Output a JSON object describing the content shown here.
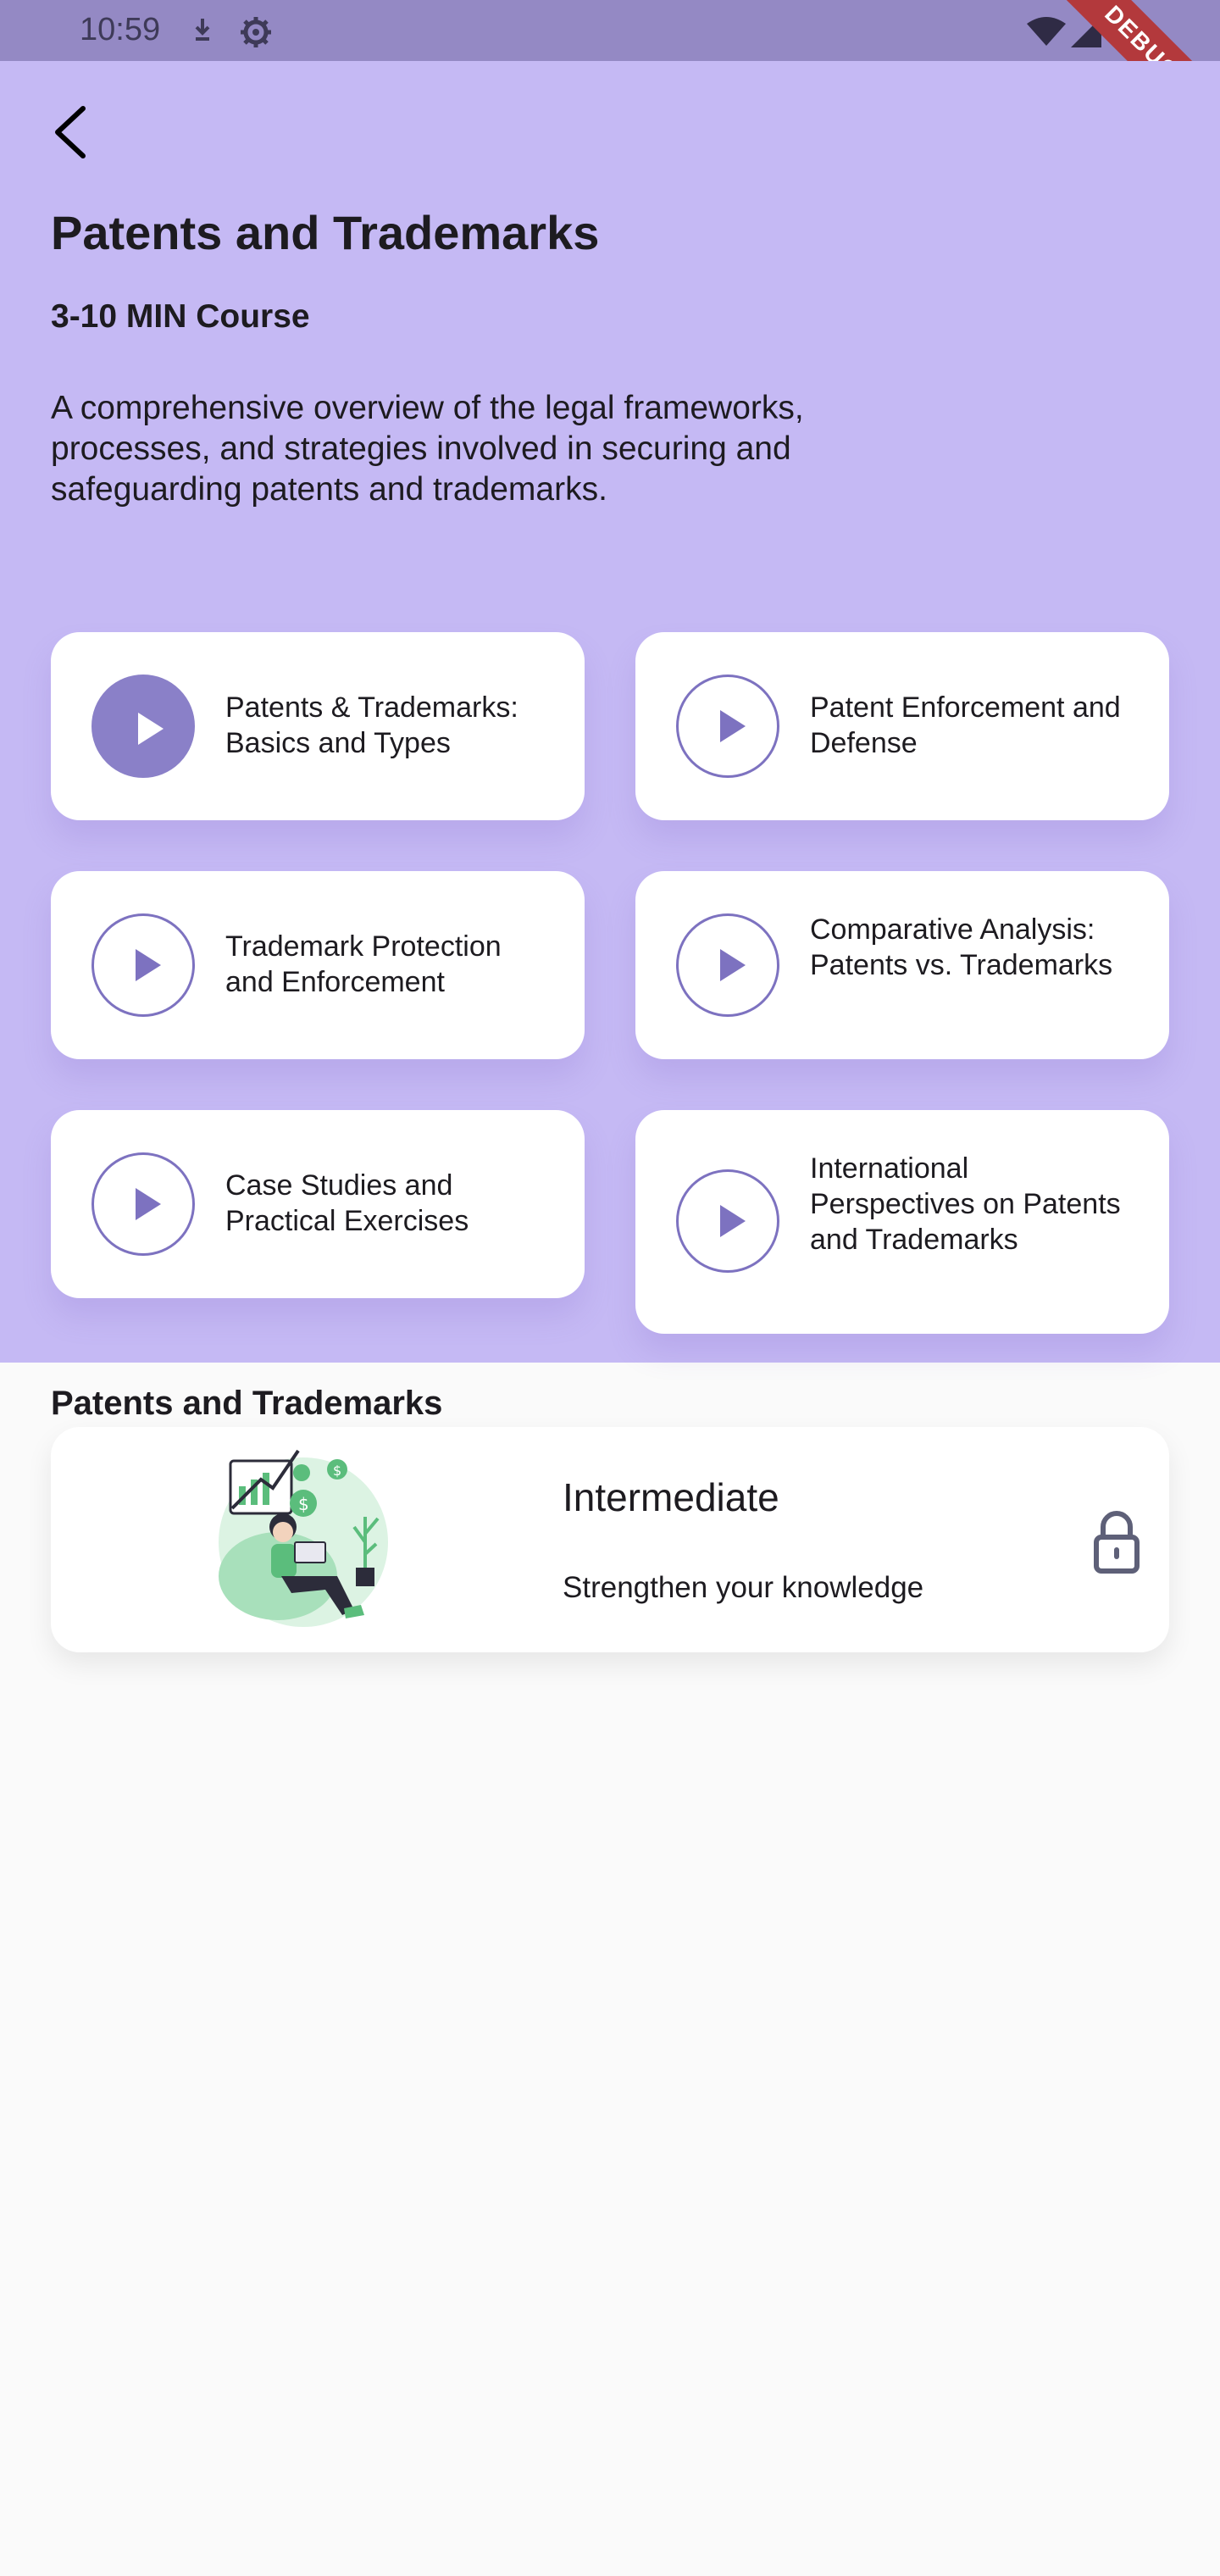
{
  "status_bar": {
    "time": "10:59"
  },
  "debug_banner": "DEBUG",
  "course": {
    "title": "Patents and Trademarks",
    "duration": "3-10 MIN Course",
    "description": "A comprehensive overview of the legal frameworks, processes, and strategies involved in securing and safeguarding patents and trademarks."
  },
  "lessons": [
    {
      "label": "Patents & Trademarks: Basics and Types",
      "active": true
    },
    {
      "label": "Patent Enforcement and Defense",
      "active": false
    },
    {
      "label": "Trademark Protection and Enforcement",
      "active": false
    },
    {
      "label": "Comparative Analysis: Patents vs. Trademarks",
      "active": false
    },
    {
      "label": "Case Studies and Practical Exercises",
      "active": false
    },
    {
      "label": "International Perspectives on Patents and Trademarks",
      "active": false
    }
  ],
  "section": {
    "title": "Patents and Trademarks",
    "level": {
      "title": "Intermediate",
      "subtitle": "Strengthen your knowledge",
      "locked": true
    }
  },
  "colors": {
    "hero_bg": "#c5b9f4",
    "accent": "#8a80c8",
    "status_bar": "#9489c4"
  }
}
